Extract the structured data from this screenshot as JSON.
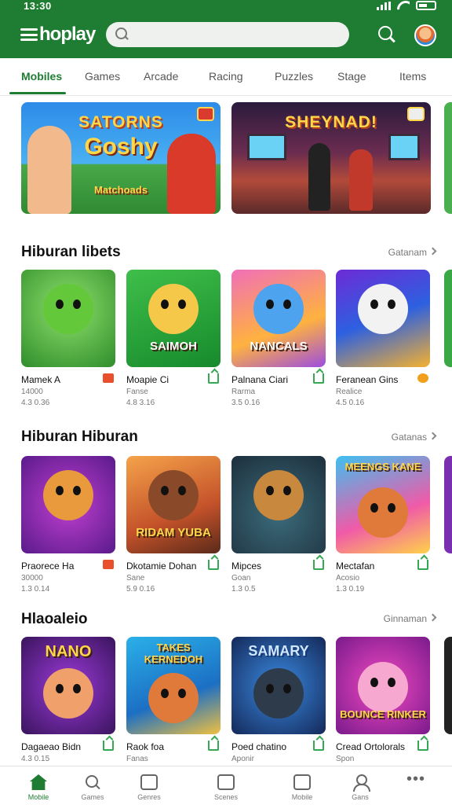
{
  "status": {
    "time": "13:30"
  },
  "header": {
    "logo": "hoplay",
    "search_placeholder": "",
    "accent_color": "#1e7d32"
  },
  "tabs": [
    {
      "label": "Mobiles"
    },
    {
      "label": "Games"
    },
    {
      "label": "Arcade"
    },
    {
      "label": "Racing"
    },
    {
      "label": "Puzzles"
    },
    {
      "label": "Stage"
    },
    {
      "label": "Items"
    }
  ],
  "banners": [
    {
      "title": "SATORNS",
      "subtitle": "Goshy",
      "tag": "Matchoads"
    },
    {
      "title": "SHEYNAD!",
      "subtitle": "",
      "tag": ""
    }
  ],
  "sections": [
    {
      "title": "Hiburan libets",
      "see_all": "Gatanam",
      "items": [
        {
          "art": "",
          "name": "Mamek A",
          "meta": "14000",
          "rating": "4.3 0.36"
        },
        {
          "art": "SAIMOH",
          "name": "Moapie Ci",
          "meta": "Fanse",
          "rating": "4.8 3.16"
        },
        {
          "art": "NANCALS",
          "name": "Palnana Ciari",
          "meta": "Rarma",
          "rating": "3.5 0.16"
        },
        {
          "art": "",
          "name": "Feranean Gins",
          "meta": "Realice",
          "rating": "4.5 0.16"
        }
      ]
    },
    {
      "title": "Hiburan Hiburan",
      "see_all": "Gatanas",
      "items": [
        {
          "art": "",
          "name": "Praorece Ha",
          "meta": "30000",
          "rating": "1.3 0.14"
        },
        {
          "art": "RIDAM YUBA",
          "name": "Dkotamie Dohan",
          "meta": "Sane",
          "rating": "5.9 0.16"
        },
        {
          "art": "",
          "name": "Mipces",
          "meta": "Goan",
          "rating": "1.3 0.5"
        },
        {
          "art": "MEENGS KANE",
          "name": "Mectafan",
          "meta": "Acosio",
          "rating": "1.3 0.19"
        }
      ]
    },
    {
      "title": "Hlaoaleio",
      "see_all": "Ginnaman",
      "items": [
        {
          "art": "NANO",
          "name": "Dagaeao Bidn",
          "meta": "4.3 0.15",
          "rating": ""
        },
        {
          "art": "TAKES KERNEDOH",
          "name": "Raok foa",
          "meta": "Fanas",
          "rating": ""
        },
        {
          "art": "SAMARY",
          "name": "Poed chatino",
          "meta": "Aponir",
          "rating": ""
        },
        {
          "art": "BOUNCE RINKER",
          "name": "Cread Ortolorals",
          "meta": "Spon",
          "rating": ""
        }
      ]
    }
  ],
  "bottom_nav": [
    {
      "label": "Mobile",
      "icon": "home-icon"
    },
    {
      "label": "Games",
      "icon": "search-icon"
    },
    {
      "label": "Genres",
      "icon": "grid-icon"
    },
    {
      "label": "Scenes",
      "icon": "image-icon"
    },
    {
      "label": "Mobile",
      "icon": "box-icon"
    },
    {
      "label": "Gans",
      "icon": "person-icon"
    },
    {
      "label": "",
      "icon": "more-icon"
    }
  ]
}
